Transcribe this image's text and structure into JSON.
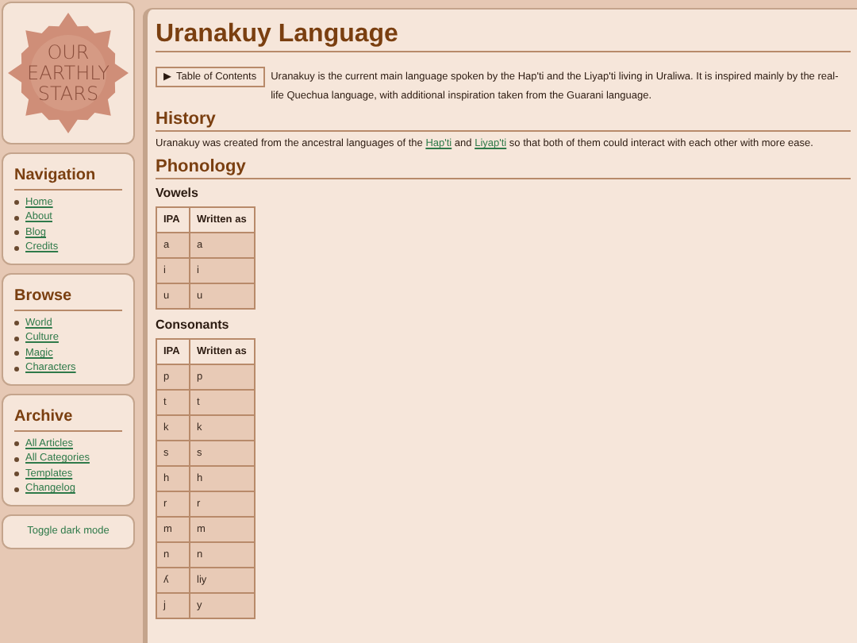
{
  "logo": {
    "lines": [
      "OUR",
      "EARTHLY",
      "STARS"
    ]
  },
  "sidebar": [
    {
      "title": "Navigation",
      "links": [
        "Home",
        "About",
        "Blog",
        "Credits"
      ]
    },
    {
      "title": "Browse",
      "links": [
        "World",
        "Culture",
        "Magic",
        "Characters"
      ]
    },
    {
      "title": "Archive",
      "links": [
        "All Articles",
        "All Categories",
        "Templates",
        "Changelog"
      ]
    }
  ],
  "dark_mode_button": "Toggle dark mode",
  "page": {
    "title": "Uranakuy Language",
    "toc": {
      "arrow": "▶",
      "label": "Table of Contents"
    },
    "intro": "Uranakuy is the current main language spoken by the Hap'ti and the Liyap'ti living in Uraliwa. It is inspired mainly by the real-life Quechua language, with additional inspiration taken from the Guarani language.",
    "sections": [
      {
        "heading": "History",
        "parts": [
          {
            "kind": "text",
            "text": "Uranakuy was created from the ancestral languages of the "
          },
          {
            "kind": "link",
            "text": "Hap'ti"
          },
          {
            "kind": "text",
            "text": " and "
          },
          {
            "kind": "link",
            "text": "Liyap'ti"
          },
          {
            "kind": "text",
            "text": " so that both of them could interact with each other with more ease."
          }
        ]
      },
      {
        "heading": "Phonology",
        "tables": [
          {
            "title": "Vowels",
            "columns": [
              "IPA",
              "Written as"
            ],
            "rows": [
              [
                "a",
                "a"
              ],
              [
                "i",
                "i"
              ],
              [
                "u",
                "u"
              ]
            ]
          },
          {
            "title": "Consonants",
            "columns": [
              "IPA",
              "Written as"
            ],
            "rows": [
              [
                "p",
                "p"
              ],
              [
                "t",
                "t"
              ],
              [
                "k",
                "k"
              ],
              [
                "s",
                "s"
              ],
              [
                "h",
                "h"
              ],
              [
                "r",
                "r"
              ],
              [
                "m",
                "m"
              ],
              [
                "n",
                "n"
              ],
              [
                "ʎ",
                "liy"
              ],
              [
                "j",
                "y"
              ]
            ]
          }
        ]
      }
    ]
  }
}
